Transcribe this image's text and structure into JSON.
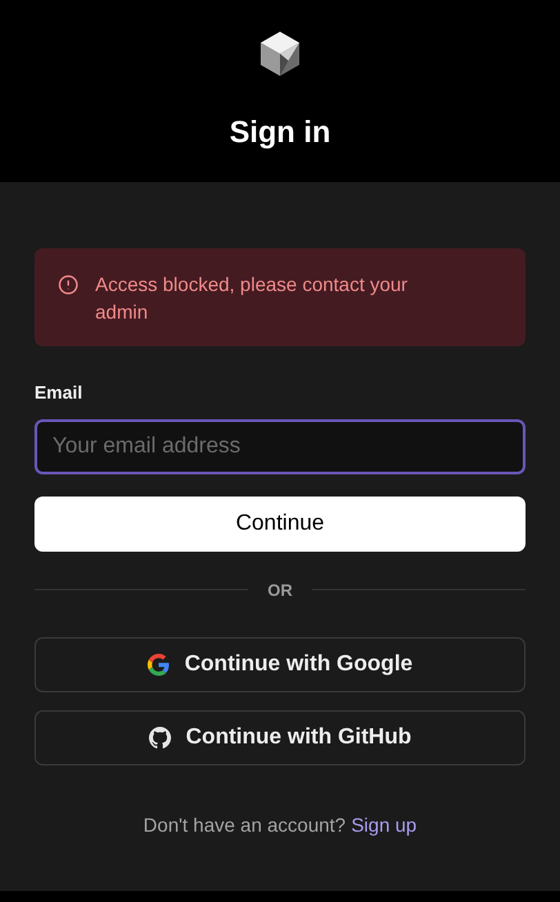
{
  "header": {
    "title": "Sign in"
  },
  "alert": {
    "message": "Access blocked, please contact your admin"
  },
  "email": {
    "label": "Email",
    "placeholder": "Your email address"
  },
  "continue_button": "Continue",
  "divider": "OR",
  "social_buttons": [
    {
      "kind": "google",
      "label": "Continue with Google"
    },
    {
      "kind": "github",
      "label": "Continue with GitHub"
    }
  ],
  "footer": {
    "text": "Don't have an account?",
    "link": "Sign up"
  }
}
